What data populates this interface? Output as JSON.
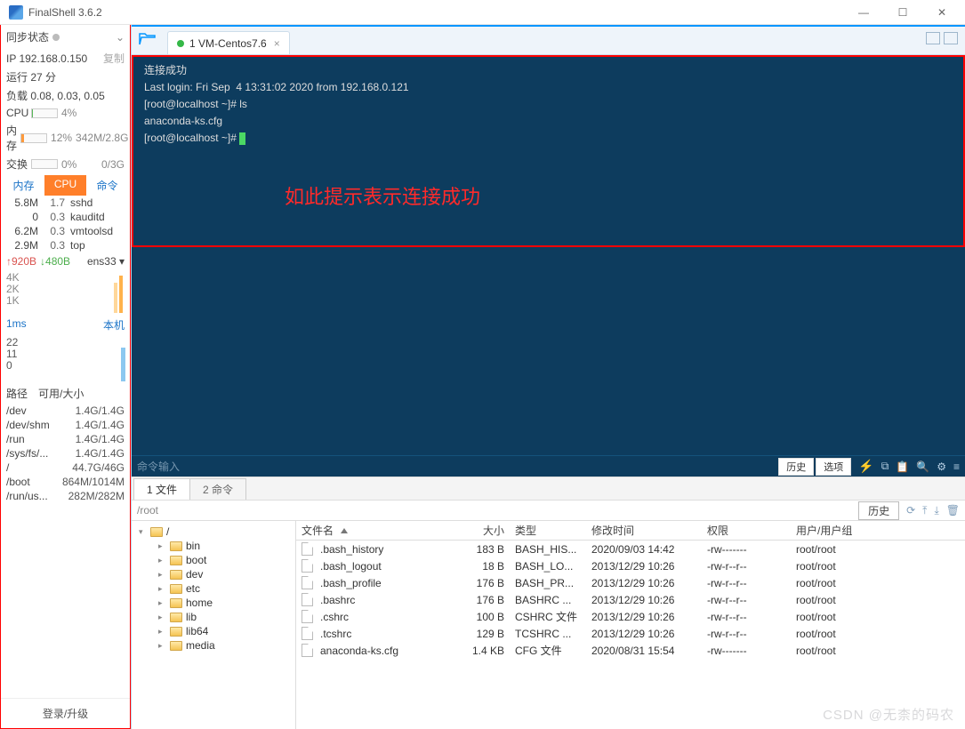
{
  "window": {
    "title": "FinalShell 3.6.2"
  },
  "sidebar": {
    "sync_label": "同步状态",
    "ip": "IP 192.168.0.150",
    "copy": "复制",
    "uptime": "运行 27 分",
    "load": "负载 0.08, 0.03, 0.05",
    "cpu": {
      "label": "CPU",
      "pct": "4%",
      "fill": 4,
      "color": "#58b858"
    },
    "mem": {
      "label": "内存",
      "pct": "12%",
      "right": "342M/2.8G",
      "fill": 12,
      "color": "#ff9a3c"
    },
    "swap": {
      "label": "交换",
      "pct": "0%",
      "right": "0/3G",
      "fill": 0,
      "color": "#58b858"
    },
    "ptabs": [
      "内存",
      "CPU",
      "命令"
    ],
    "procs": [
      {
        "mem": "5.8M",
        "cpu": "1.7",
        "cmd": "sshd"
      },
      {
        "mem": "0",
        "cpu": "0.3",
        "cmd": "kauditd"
      },
      {
        "mem": "6.2M",
        "cpu": "0.3",
        "cmd": "vmtoolsd"
      },
      {
        "mem": "2.9M",
        "cpu": "0.3",
        "cmd": "top"
      }
    ],
    "net": {
      "up": "↑920B",
      "down": "↓480B",
      "iface": "ens33 ▾"
    },
    "net_ticks": [
      "4K",
      "2K",
      "1K"
    ],
    "lat": {
      "ms": "1ms",
      "host": "本机",
      "t1": "22",
      "t2": "11",
      "t3": "0"
    },
    "fs_tabs": [
      "路径",
      "可用/大小"
    ],
    "fs": [
      {
        "p": "/dev",
        "v": "1.4G/1.4G"
      },
      {
        "p": "/dev/shm",
        "v": "1.4G/1.4G"
      },
      {
        "p": "/run",
        "v": "1.4G/1.4G"
      },
      {
        "p": "/sys/fs/...",
        "v": "1.4G/1.4G"
      },
      {
        "p": "/",
        "v": "44.7G/46G"
      },
      {
        "p": "/boot",
        "v": "864M/1014M"
      },
      {
        "p": "/run/us...",
        "v": "282M/282M"
      }
    ],
    "login": "登录/升级"
  },
  "tabs": {
    "active": "1 VM-Centos7.6"
  },
  "terminal": {
    "l1": "连接成功",
    "l2": "Last login: Fri Sep  4 13:31:02 2020 from 192.168.0.121",
    "l3": "[root@localhost ~]# ls",
    "l4": "anaconda-ks.cfg",
    "l5": "[root@localhost ~]# ",
    "overlay": "如此提示表示连接成功"
  },
  "cmdbar": {
    "placeholder": "命令输入",
    "history": "历史",
    "options": "选项"
  },
  "btabs": [
    "1 文件",
    "2 命令"
  ],
  "path": "/root",
  "path_hist": "历史",
  "tree": {
    "root": "/",
    "children": [
      "bin",
      "boot",
      "dev",
      "etc",
      "home",
      "lib",
      "lib64",
      "media"
    ]
  },
  "cols": [
    "文件名",
    "大小",
    "类型",
    "修改时间",
    "权限",
    "用户/用户组"
  ],
  "files": [
    {
      "n": ".bash_history",
      "s": "183 B",
      "t": "BASH_HIS...",
      "d": "2020/09/03 14:42",
      "p": "-rw-------",
      "u": "root/root"
    },
    {
      "n": ".bash_logout",
      "s": "18 B",
      "t": "BASH_LO...",
      "d": "2013/12/29 10:26",
      "p": "-rw-r--r--",
      "u": "root/root"
    },
    {
      "n": ".bash_profile",
      "s": "176 B",
      "t": "BASH_PR...",
      "d": "2013/12/29 10:26",
      "p": "-rw-r--r--",
      "u": "root/root"
    },
    {
      "n": ".bashrc",
      "s": "176 B",
      "t": "BASHRC ...",
      "d": "2013/12/29 10:26",
      "p": "-rw-r--r--",
      "u": "root/root"
    },
    {
      "n": ".cshrc",
      "s": "100 B",
      "t": "CSHRC 文件",
      "d": "2013/12/29 10:26",
      "p": "-rw-r--r--",
      "u": "root/root"
    },
    {
      "n": ".tcshrc",
      "s": "129 B",
      "t": "TCSHRC ...",
      "d": "2013/12/29 10:26",
      "p": "-rw-r--r--",
      "u": "root/root"
    },
    {
      "n": "anaconda-ks.cfg",
      "s": "1.4 KB",
      "t": "CFG 文件",
      "d": "2020/08/31 15:54",
      "p": "-rw-------",
      "u": "root/root"
    }
  ],
  "watermark": "CSDN @无柰的码农"
}
